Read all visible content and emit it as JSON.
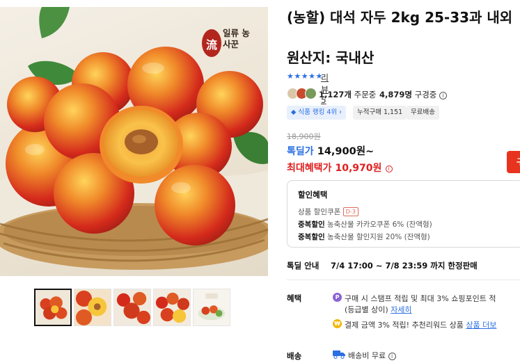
{
  "product": {
    "title": "(농할) 대석 자두 2kg 25-33과 내외",
    "origin": "원산지: 국내산",
    "brand_seal_mark": "流",
    "brand_seal_text": "일류 농사꾼",
    "stars": "★★★★★",
    "review_link": "리뷰 5",
    "buyers_count": "1,127개",
    "buyers_suffix": " 주문중",
    "wish_count": "4,879명",
    "wish_suffix": " 구경중",
    "info_icon": "i",
    "tags": {
      "rank": "◆ 식품 랭킹 4위 ›",
      "cumulative": "누적구매 1,151",
      "free_shipping": "무료배송"
    }
  },
  "price": {
    "list_price": "18,900원",
    "deal_label": "톡딜가",
    "deal_price": "14,900원~",
    "max_label": "최대혜택가",
    "max_price": "10,970원",
    "buy_button": "구매"
  },
  "discount_box": {
    "title": "할인혜택",
    "coupon_label": "상품 할인쿠폰",
    "coupon_badge": "D-3",
    "dup1_label": "중복할인",
    "dup1_text": " 농축산물 카카오쿠폰 6% (잔액형)",
    "dup2_label": "중복할인",
    "dup2_text": " 농축산물 할인지원 20% (잔액형)",
    "edge_dash": "-"
  },
  "sale": {
    "label": "톡딜 안내",
    "period": "7/4 17:00 ~ 7/8 23:59 까지 한정판매"
  },
  "benefits": {
    "label": "혜택",
    "perk1_icon": "P",
    "perk1_line1": "구매 시 스탬프 적립 및 최대 3% 쇼핑포인트 적",
    "perk1_line2": "(등급별 상이) ",
    "perk1_link": "자세히",
    "perk2_icon": "₩",
    "perk2_text": "결제 금액 3% 적립! 추천리워드 상품 ",
    "perk2_link": "상품 더보"
  },
  "shipping": {
    "label": "배송",
    "text": "배송비 무료",
    "info_icon": "i"
  },
  "thumbnails": [
    "thumb-1",
    "thumb-2",
    "thumb-3",
    "thumb-4",
    "thumb-5"
  ],
  "colors": {
    "accent_blue": "#2a6fe3",
    "sale_red": "#e02020",
    "buy_red": "#e8331f",
    "plum_red": "#d42a1c",
    "plum_yellow": "#f6c53a"
  }
}
